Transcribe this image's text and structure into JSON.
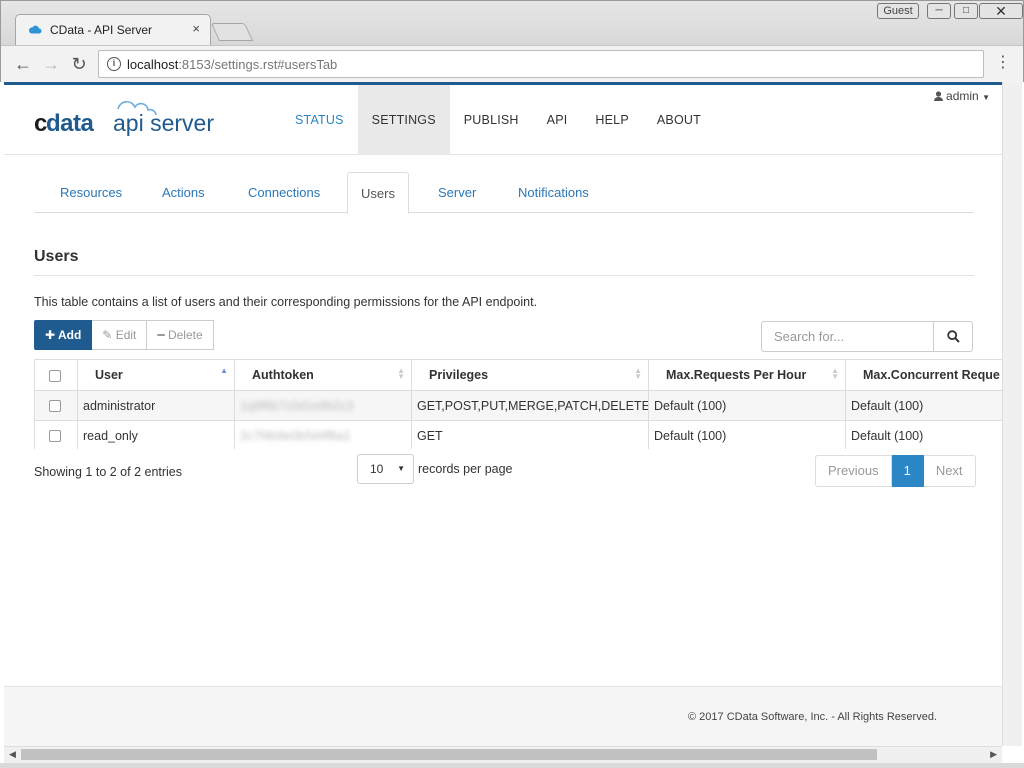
{
  "browser": {
    "tab_title": "CData - API Server",
    "tab_close": "×",
    "guest_label": "Guest",
    "url_host": "localhost",
    "url_path": ":8153/settings.rst#usersTab"
  },
  "app": {
    "logo_text": "cdata api server",
    "nav": [
      "STATUS",
      "SETTINGS",
      "PUBLISH",
      "API",
      "HELP",
      "ABOUT"
    ],
    "user_menu": "admin"
  },
  "subtabs": [
    "Resources",
    "Actions",
    "Connections",
    "Users",
    "Server",
    "Notifications"
  ],
  "section": {
    "title": "Users",
    "description": "This table contains a list of users and their corresponding permissions for the API endpoint."
  },
  "toolbar": {
    "add_label": "Add",
    "edit_label": "Edit",
    "delete_label": "Delete"
  },
  "search": {
    "placeholder": "Search for..."
  },
  "table": {
    "columns": [
      "User",
      "Authtoken",
      "Privileges",
      "Max.Requests Per Hour",
      "Max.Concurrent Reque"
    ],
    "rows": [
      {
        "user": "administrator",
        "authtoken": "1q9f6b7c0d1e9b2c3",
        "privileges": "GET,POST,PUT,MERGE,PATCH,DELETE",
        "max_requests": "Default (100)",
        "max_concurrent": "Default (100)"
      },
      {
        "user": "read_only",
        "authtoken": "2c7f4b9e0b5d4f8a1",
        "privileges": "GET",
        "max_requests": "Default (100)",
        "max_concurrent": "Default (100)"
      }
    ]
  },
  "pagination": {
    "info": "Showing 1 to 2 of 2 entries",
    "page_length": "10",
    "records_label": "records per page",
    "previous": "Previous",
    "current": "1",
    "next": "Next"
  },
  "footer": {
    "text": "© 2017 CData Software, Inc. - All Rights Reserved."
  },
  "colors": {
    "brand": "#1f5b8e",
    "link": "#2a78b7",
    "active_page": "#2a86c5"
  }
}
